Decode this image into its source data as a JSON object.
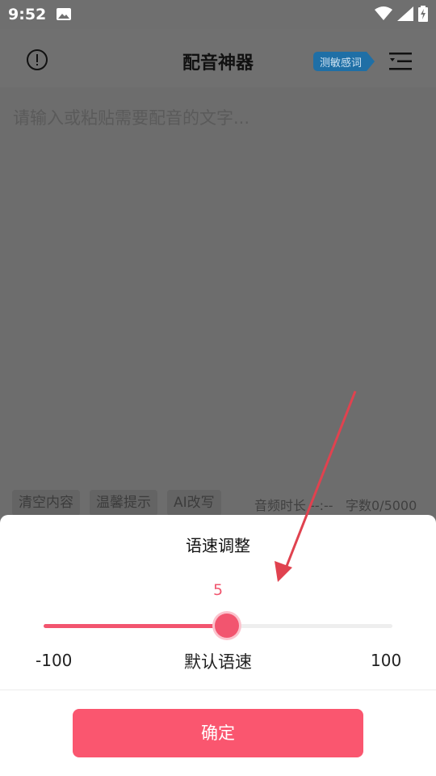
{
  "status_bar": {
    "time": "9:52",
    "icons": [
      "image-icon",
      "wifi-icon",
      "signal-icon",
      "battery-charging-icon"
    ]
  },
  "app_bar": {
    "title": "配音神器",
    "info_icon": "info-icon",
    "sensitive_badge": "测敏感词",
    "menu_icon": "menu-icon"
  },
  "editor": {
    "placeholder": "请输入或粘贴需要配音的文字..."
  },
  "toolbar": {
    "clear_label": "清空内容",
    "tips_label": "温馨提示",
    "ai_label": "AI改写",
    "audio_duration": "音频时长 --:--",
    "char_count": "字数0/5000"
  },
  "speed_sheet": {
    "title": "语速调整",
    "value": "5",
    "value_numeric": 5,
    "min_label": "-100",
    "max_label": "100",
    "default_label": "默认语速",
    "min": -100,
    "max": 100,
    "confirm_label": "确定"
  },
  "colors": {
    "accent": "#fa566f",
    "badge": "#1f6fa6",
    "overlay": "#6f6f6f",
    "annotation_arrow": "#e0424f"
  }
}
